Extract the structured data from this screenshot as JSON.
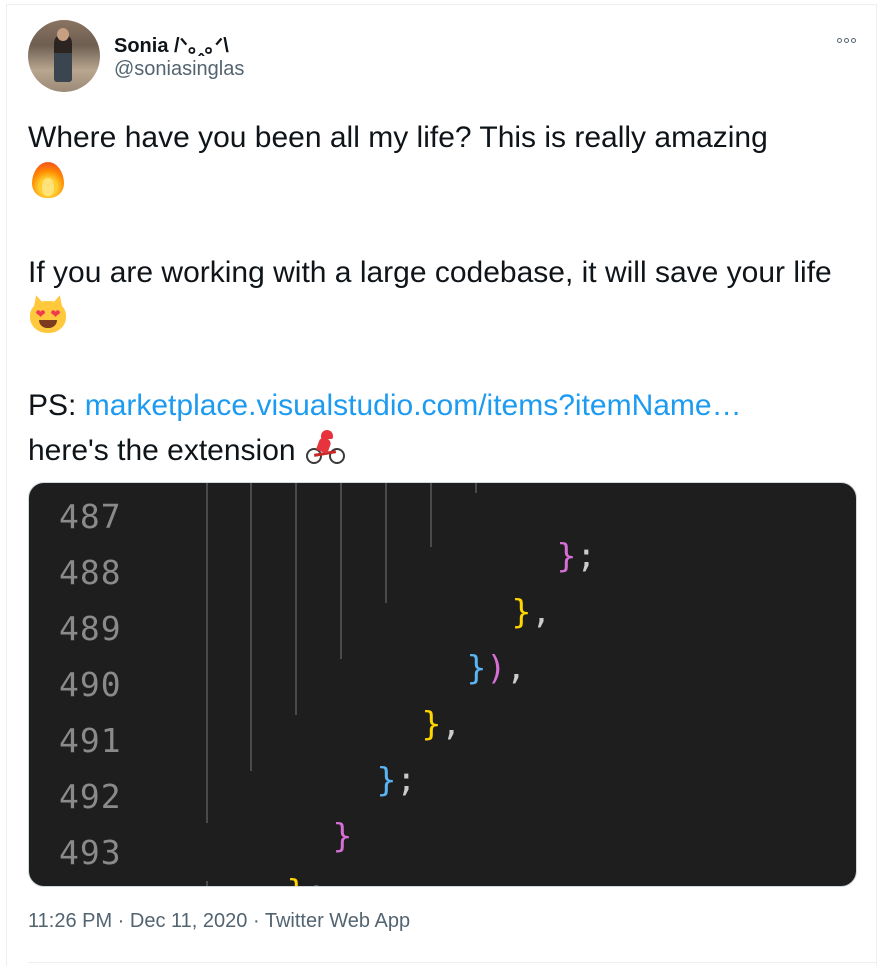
{
  "author": {
    "display_name": "Sonia /ᐠ｡ꞈ｡ᐟ\\",
    "handle": "@soniasinglas",
    "avatar": "profile-photo-person-standing"
  },
  "more_icon": "more-dots-icon",
  "tweet": {
    "line1": "Where have you been all my life? This is really amazing",
    "line1_emoji": "fire-emoji",
    "line2": "If you are working with a large codebase, it will save your life",
    "line2_emoji": "smiling-cat-heart-eyes-emoji",
    "ps_label": "PS: ",
    "link_text": "marketplace.visualstudio.com/items?itemName…",
    "line4": "here's the extension",
    "line4_emoji": "woman-biking-emoji"
  },
  "code_image": {
    "lines": [
      {
        "number": "487",
        "code": "};"
      },
      {
        "number": "488",
        "code": "},"
      },
      {
        "number": "489",
        "code": "}),"
      },
      {
        "number": "490",
        "code": "},"
      },
      {
        "number": "491",
        "code": "};"
      },
      {
        "number": "492",
        "code": "}"
      },
      {
        "number": "493",
        "code": "};"
      }
    ],
    "colors": {
      "background": "#1e1e1e",
      "pink": "#d670d6",
      "gold": "#ffd700",
      "blue": "#5bb5f5",
      "line_number": "#8a8a8a"
    }
  },
  "footer": {
    "time": "11:26 PM",
    "date": "Dec 11, 2020",
    "source": "Twitter Web App",
    "separator": " · "
  },
  "colors": {
    "link": "#1d9bf0",
    "secondary_text": "#536471",
    "primary_text": "#0f1419"
  }
}
